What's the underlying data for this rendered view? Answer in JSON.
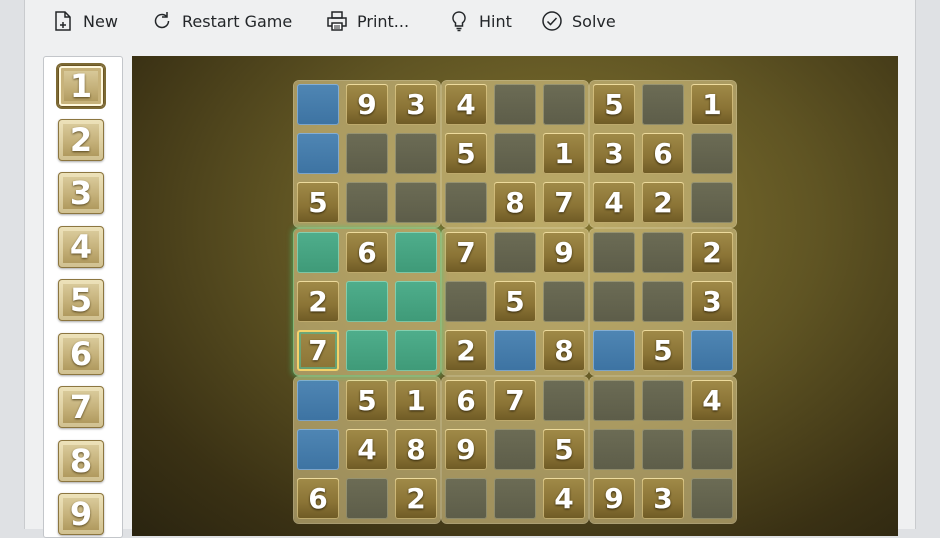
{
  "toolbar": {
    "new_label": "New",
    "restart_label": "Restart Game",
    "print_label": "Print...",
    "hint_label": "Hint",
    "solve_label": "Solve"
  },
  "number_panel": {
    "numbers": [
      "1",
      "2",
      "3",
      "4",
      "5",
      "6",
      "7",
      "8",
      "9"
    ],
    "selected": "1"
  },
  "board": {
    "rows": [
      [
        "",
        "9",
        "3",
        "4",
        "",
        "",
        "5",
        "",
        "1"
      ],
      [
        "",
        "",
        "",
        "5",
        "",
        "1",
        "3",
        "6",
        ""
      ],
      [
        "5",
        "",
        "",
        "",
        "8",
        "7",
        "4",
        "2",
        ""
      ],
      [
        "",
        "6",
        "",
        "7",
        "",
        "9",
        "",
        "",
        "2"
      ],
      [
        "2",
        "",
        "",
        "",
        "5",
        "",
        "",
        "",
        "3"
      ],
      [
        "7",
        "",
        "",
        "2",
        "",
        "8",
        "",
        "5",
        ""
      ],
      [
        "",
        "5",
        "1",
        "6",
        "7",
        "",
        "",
        "",
        "4"
      ],
      [
        "",
        "4",
        "8",
        "9",
        "",
        "5",
        "",
        "",
        ""
      ],
      [
        "6",
        "",
        "2",
        "",
        "",
        "4",
        "9",
        "3",
        ""
      ]
    ],
    "selected_cell": [
      5,
      0
    ],
    "highlight_colors": {
      "row_col": "#3d73a2",
      "box": "#3f9a78"
    }
  }
}
